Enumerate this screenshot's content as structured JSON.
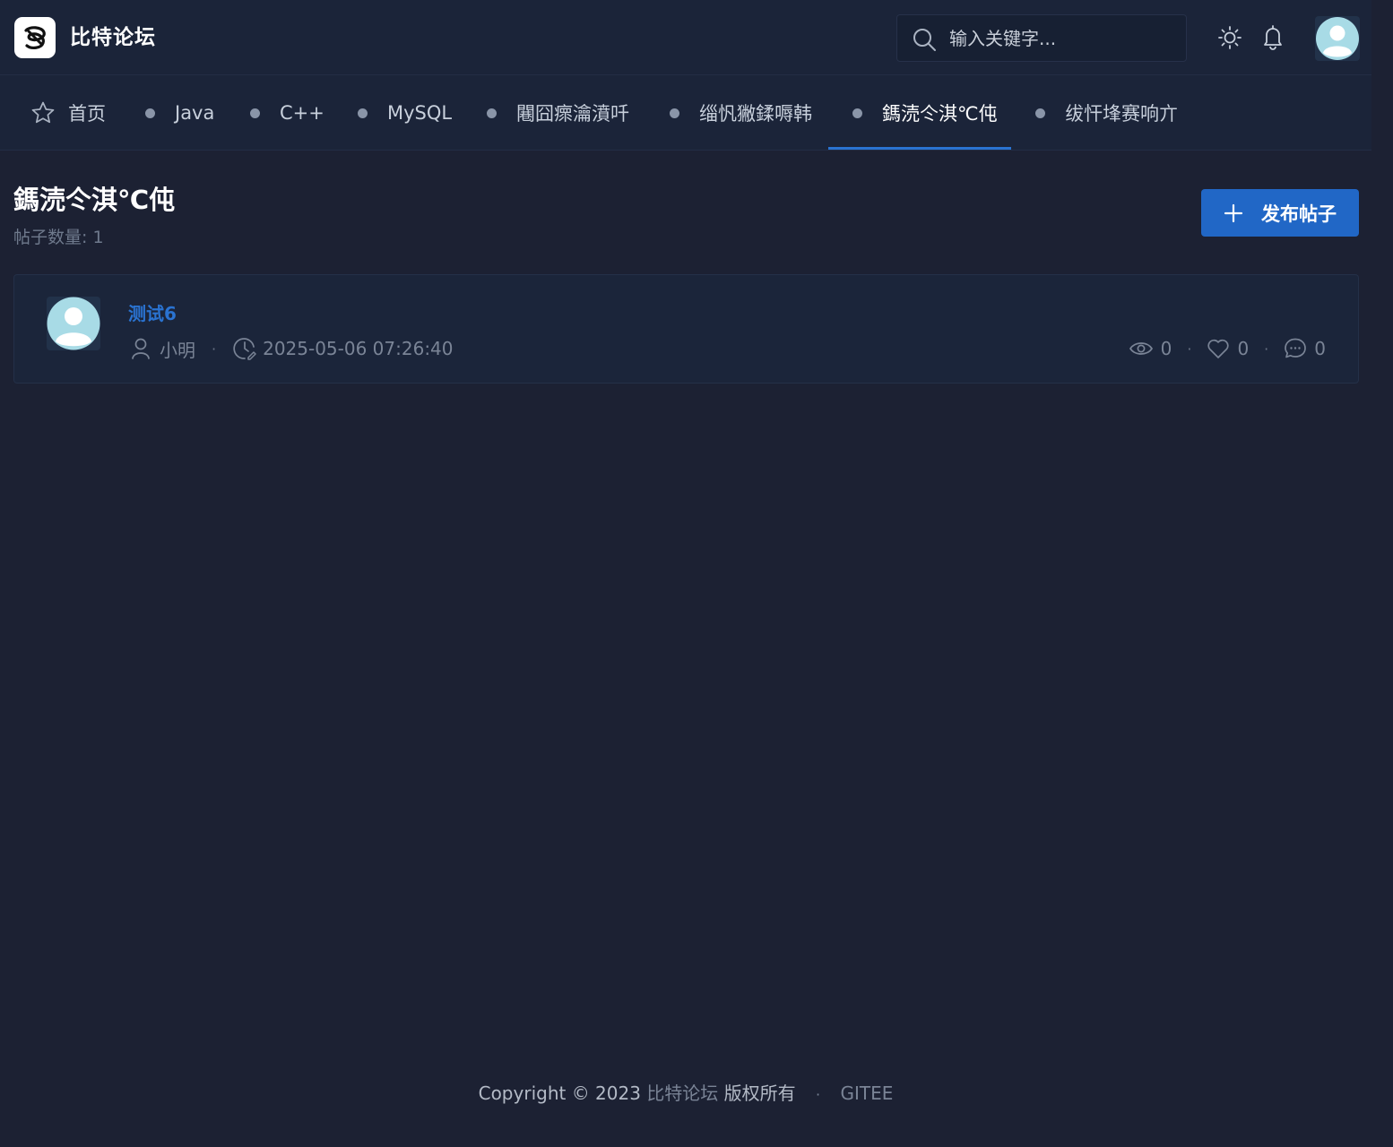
{
  "header": {
    "brand": "比特论坛",
    "search_placeholder": "输入关键字..."
  },
  "nav": {
    "items": [
      {
        "label": "首页",
        "icon": "star-icon"
      },
      {
        "label": "Java",
        "icon": "dot"
      },
      {
        "label": "C++",
        "icon": "dot"
      },
      {
        "label": "MySQL",
        "icon": "dot"
      },
      {
        "label": "闀囧瘝瀹濆吀",
        "icon": "dot"
      },
      {
        "label": "缁忛獙鍒嗕韩",
        "icon": "dot"
      },
      {
        "label": "鎷涜仒淇℃伅",
        "icon": "dot",
        "active": true
      },
      {
        "label": "绂忓埄赛响亣",
        "icon": "dot"
      }
    ]
  },
  "board": {
    "title": "鎷涜仒淇℃伅",
    "count_text": "帖子数量: 1",
    "publish_label": "发布帖子"
  },
  "posts": [
    {
      "title": "测试6",
      "author": "小明",
      "time": "2025-05-06 07:26:40",
      "views": "0",
      "likes": "0",
      "comments": "0"
    }
  ],
  "footer": {
    "copyright": "Copyright © 2023",
    "site": "比特论坛",
    "rights": "版权所有",
    "link": "GITEE"
  },
  "colors": {
    "background": "#1c2133",
    "header": "#1b2439",
    "accent": "#2a73d1",
    "button": "#2167c6"
  }
}
